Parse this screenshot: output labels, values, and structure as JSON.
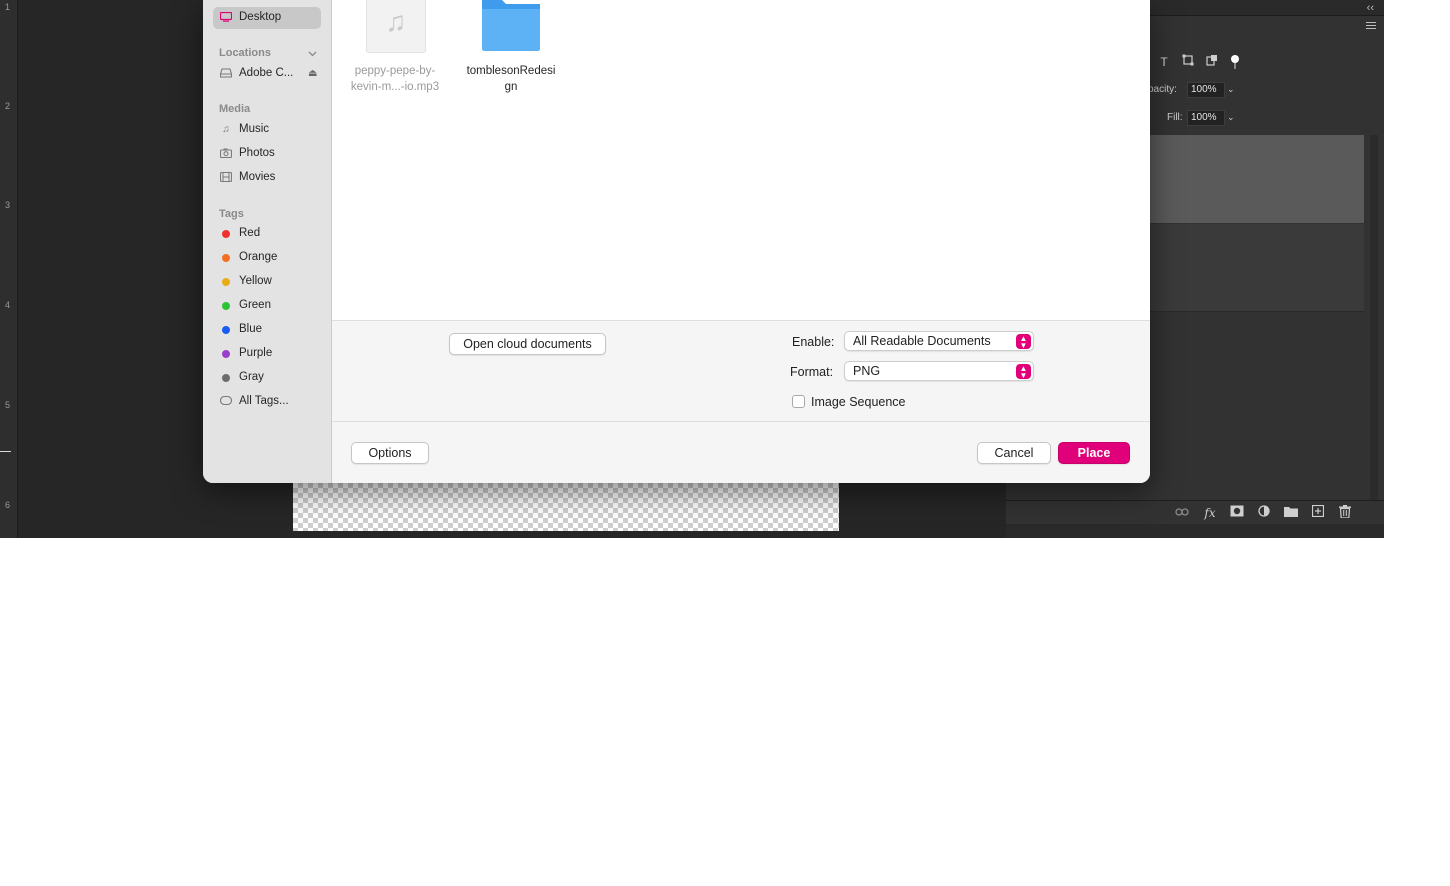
{
  "ruler": {
    "numbers": [
      "1",
      "2",
      "3",
      "4",
      "5",
      "6"
    ]
  },
  "layers_panel": {
    "opacity_label": "pacity:",
    "opacity_value": "100%",
    "fill_label": "Fill:",
    "fill_value": "100%"
  },
  "sidebar": {
    "desktop_label": "Desktop",
    "locations_header": "Locations",
    "locations": [
      {
        "label": "Adobe C..."
      }
    ],
    "media_header": "Media",
    "media": [
      {
        "label": "Music",
        "icon": "music-note-icon"
      },
      {
        "label": "Photos",
        "icon": "camera-icon"
      },
      {
        "label": "Movies",
        "icon": "film-icon"
      }
    ],
    "tags_header": "Tags",
    "tags": [
      {
        "label": "Red",
        "color": "#f0312f"
      },
      {
        "label": "Orange",
        "color": "#f27121"
      },
      {
        "label": "Yellow",
        "color": "#e7ad14"
      },
      {
        "label": "Green",
        "color": "#2ec236"
      },
      {
        "label": "Blue",
        "color": "#1a5cf2"
      },
      {
        "label": "Purple",
        "color": "#9b3ecb"
      },
      {
        "label": "Gray",
        "color": "#6c6c6c"
      }
    ],
    "all_tags_label": "All Tags..."
  },
  "files": [
    {
      "name_line1": "peppy-pepe-by-",
      "name_line2": "kevin-m...-io.mp3",
      "type": "audio",
      "icon": "music-note-icon",
      "enabled": false
    },
    {
      "name_line1": "tomblesonRedesi",
      "name_line2": "gn",
      "type": "folder",
      "icon": "folder-icon",
      "enabled": true
    }
  ],
  "options": {
    "open_cloud_label": "Open cloud documents",
    "enable_label": "Enable:",
    "enable_value": "All Readable Documents",
    "format_label": "Format:",
    "format_value": "PNG",
    "image_sequence_label": "Image Sequence",
    "image_sequence_checked": false
  },
  "footer": {
    "options_label": "Options",
    "cancel_label": "Cancel",
    "place_label": "Place"
  },
  "colors": {
    "accent": "#e0007a",
    "folder": "#3a9ef0"
  }
}
